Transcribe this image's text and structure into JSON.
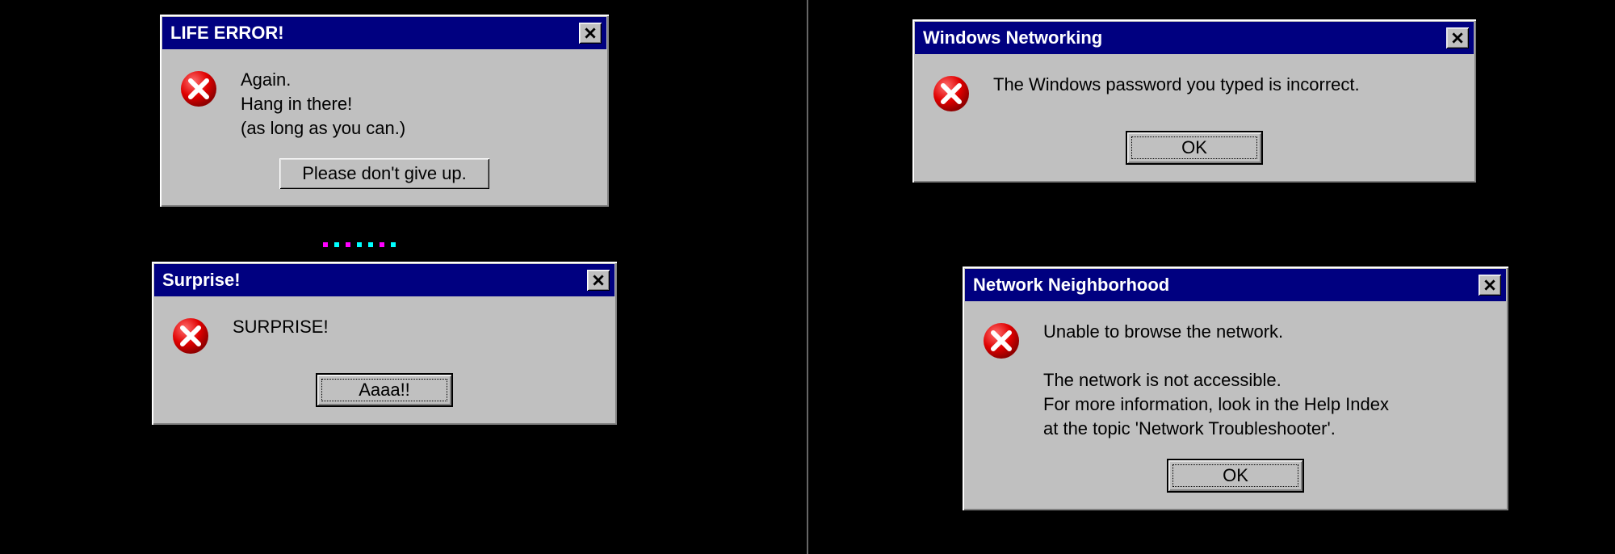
{
  "dialogs": [
    {
      "title": "LIFE ERROR!",
      "message": "Again.\nHang in there!\n(as long as you can.)",
      "button": "Please don't give up.",
      "selected": false
    },
    {
      "title": "Surprise!",
      "message": "SURPRISE!",
      "button": "Aaaa!!",
      "selected": true
    },
    {
      "title": "Windows Networking",
      "message": "The Windows password you typed is incorrect.",
      "button": "OK",
      "selected": true
    },
    {
      "title": "Network Neighborhood",
      "message": "Unable to browse the network.\n\nThe network is not accessible.\nFor more information, look in the Help Index\nat the topic 'Network Troubleshooter'.",
      "button": "OK",
      "selected": true
    }
  ]
}
